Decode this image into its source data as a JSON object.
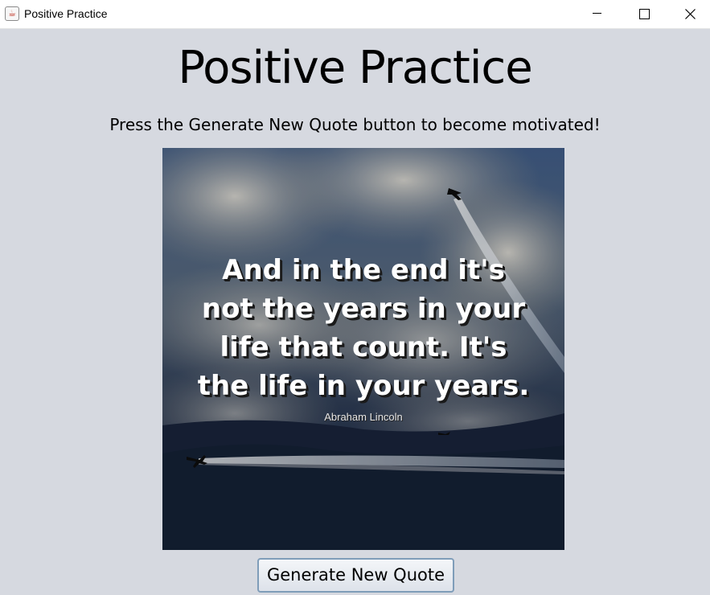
{
  "window": {
    "title": "Positive Practice",
    "icon": "java-cup-icon",
    "controls": [
      "minimize-icon",
      "maximize-icon",
      "close-icon"
    ]
  },
  "main": {
    "heading": "Positive Practice",
    "subheading": "Press the Generate New Quote button to become motivated!",
    "quote_image": {
      "quote_lines": [
        "And in the end it's",
        "not the years in your",
        "life that count. It's",
        "the life in your years."
      ],
      "author": "Abraham Lincoln"
    },
    "generate_button_label": "Generate New Quote"
  },
  "colors": {
    "background": "#d6d9e0",
    "button_border": "#7f9db9"
  }
}
